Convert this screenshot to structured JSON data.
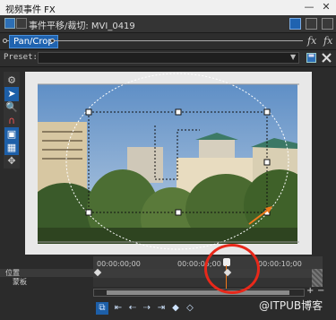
{
  "window": {
    "title": "视频事件 FX",
    "minimize_glyph": "—",
    "close_glyph": "✕"
  },
  "header": {
    "event_label": "事件平移/裁切: MVI_0419",
    "colors": {
      "accent_blue": "#1f63b0",
      "header_bg": "#343434"
    }
  },
  "fx_chain": {
    "selected_tab": "Pan/Crop",
    "fx_glyph": "fx"
  },
  "preset": {
    "label": "Preset:",
    "value": ""
  },
  "tools": [
    {
      "name": "gear-icon",
      "glyph": "⚙"
    },
    {
      "name": "pointer-icon",
      "glyph": "➤",
      "selected": true
    },
    {
      "name": "zoom-icon",
      "glyph": "🔍"
    },
    {
      "name": "magnet-icon",
      "glyph": "∩"
    },
    {
      "name": "lock-aspect-icon",
      "glyph": "▣"
    },
    {
      "name": "snap-grid-icon",
      "glyph": "▦"
    },
    {
      "name": "move-free-icon",
      "glyph": "✥"
    }
  ],
  "timeline": {
    "lanes": {
      "position": "位置",
      "mask": "蒙板"
    },
    "ticks": [
      "00:00:00;00",
      "00:00:05;00",
      "00:00:10;00"
    ],
    "zoom_in": "+",
    "zoom_out": "−"
  },
  "bottom": {
    "buttons": [
      {
        "name": "sync-cursor-icon",
        "glyph": "⧉"
      },
      {
        "name": "first-keyframe-icon",
        "glyph": "⇤"
      },
      {
        "name": "prev-keyframe-icon",
        "glyph": "⇠"
      },
      {
        "name": "next-keyframe-icon",
        "glyph": "⇢"
      },
      {
        "name": "last-keyframe-icon",
        "glyph": "⇥"
      },
      {
        "name": "add-keyframe-icon",
        "glyph": "◆"
      },
      {
        "name": "delete-keyframe-icon",
        "glyph": "◇"
      }
    ],
    "watermark": "@ITPUB博客"
  }
}
